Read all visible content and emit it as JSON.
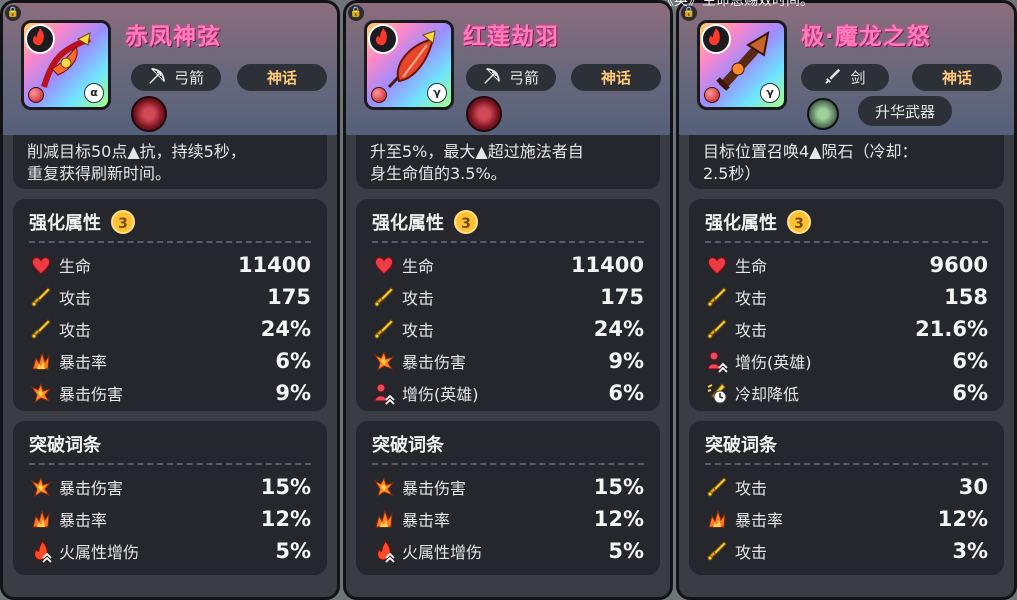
{
  "top_fragment": "《英》生命恩赐效时间。",
  "cards": [
    {
      "name": "赤凤神弦",
      "tier_letter": "α",
      "weapon_type": "弓箭",
      "weapon_icon": "bow-icon",
      "rarity": "神话",
      "emblem": "red",
      "description": [
        "削减目标50点▲抗，持续5秒，",
        "重复获得刷新时间。"
      ],
      "enhance_title": "强化属性",
      "enhance_level": "3",
      "enhance": [
        {
          "icon": "heart-icon",
          "label": "生命",
          "value": "11400"
        },
        {
          "icon": "attack-icon",
          "label": "攻击",
          "value": "175"
        },
        {
          "icon": "attack-icon",
          "label": "攻击",
          "value": "24%"
        },
        {
          "icon": "crit-rate-icon",
          "label": "暴击率",
          "value": "6%"
        },
        {
          "icon": "crit-damage-icon",
          "label": "暴击伤害",
          "value": "9%"
        }
      ],
      "break_title": "突破词条",
      "breaks": [
        {
          "icon": "crit-damage-icon",
          "label": "暴击伤害",
          "value": "15%"
        },
        {
          "icon": "crit-rate-icon",
          "label": "暴击率",
          "value": "12%"
        },
        {
          "icon": "fire-boost-icon",
          "label": "火属性增伤",
          "value": "5%"
        }
      ]
    },
    {
      "name": "红莲劫羽",
      "tier_letter": "γ",
      "weapon_type": "弓箭",
      "weapon_icon": "bow-icon",
      "rarity": "神话",
      "emblem": "red",
      "description": [
        "升至5%，最大▲超过施法者自",
        "身生命值的3.5%。"
      ],
      "enhance_title": "强化属性",
      "enhance_level": "3",
      "enhance": [
        {
          "icon": "heart-icon",
          "label": "生命",
          "value": "11400"
        },
        {
          "icon": "attack-icon",
          "label": "攻击",
          "value": "175"
        },
        {
          "icon": "attack-icon",
          "label": "攻击",
          "value": "24%"
        },
        {
          "icon": "crit-damage-icon",
          "label": "暴击伤害",
          "value": "9%"
        },
        {
          "icon": "hero-boost-icon",
          "label": "增伤(英雄)",
          "value": "6%"
        }
      ],
      "break_title": "突破词条",
      "breaks": [
        {
          "icon": "crit-damage-icon",
          "label": "暴击伤害",
          "value": "15%"
        },
        {
          "icon": "crit-rate-icon",
          "label": "暴击率",
          "value": "12%"
        },
        {
          "icon": "fire-boost-icon",
          "label": "火属性增伤",
          "value": "5%"
        }
      ]
    },
    {
      "name": "极·魔龙之怒",
      "tier_letter": "γ",
      "weapon_type": "剑",
      "weapon_icon": "sword-icon",
      "rarity": "神话",
      "emblem": "green",
      "upgrade_label": "升华武器",
      "description": [
        "目标位置召唤4▲陨石（冷却：",
        "2.5秒）"
      ],
      "enhance_title": "强化属性",
      "enhance_level": "3",
      "enhance": [
        {
          "icon": "heart-icon",
          "label": "生命",
          "value": "9600"
        },
        {
          "icon": "attack-icon",
          "label": "攻击",
          "value": "158"
        },
        {
          "icon": "attack-icon",
          "label": "攻击",
          "value": "21.6%"
        },
        {
          "icon": "hero-boost-icon",
          "label": "增伤(英雄)",
          "value": "6%"
        },
        {
          "icon": "cooldown-icon",
          "label": "冷却降低",
          "value": "6%"
        }
      ],
      "break_title": "突破词条",
      "breaks": [
        {
          "icon": "attack-icon",
          "label": "攻击",
          "value": "30"
        },
        {
          "icon": "crit-rate-icon",
          "label": "暴击率",
          "value": "12%"
        },
        {
          "icon": "attack-icon",
          "label": "攻击",
          "value": "3%"
        }
      ]
    }
  ]
}
